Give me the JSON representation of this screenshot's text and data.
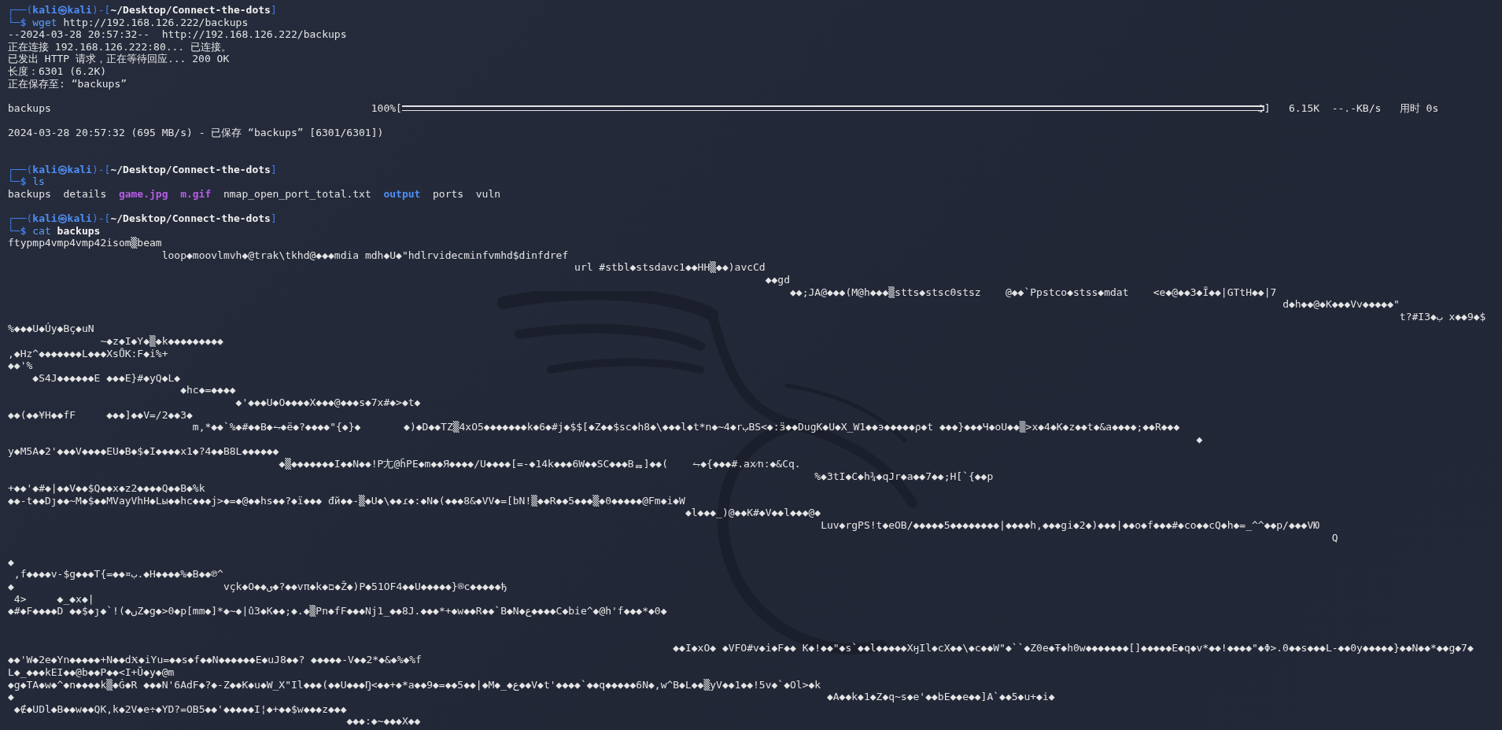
{
  "terminal": {
    "lines": [
      {
        "kind": "prompt",
        "open": "┌──(",
        "user": "kali㉿kali",
        "sep": ")-[",
        "path": "~/Desktop/Connect-the-dots",
        "close": "]"
      },
      {
        "kind": "command",
        "corner": "└─",
        "sign": "$",
        "command": "wget",
        "args": [
          {
            "text": "http://192.168.126.222/backups",
            "bold": false
          }
        ]
      },
      {
        "kind": "output",
        "text": "--2024-03-28 20:57:32--  http://192.168.126.222/backups"
      },
      {
        "kind": "output",
        "text": "正在连接 192.168.126.222:80... 已连接。"
      },
      {
        "kind": "output",
        "text": "已发出 HTTP 请求，正在等待回应... 200 OK"
      },
      {
        "kind": "output",
        "text": "长度：6301 (6.2K)"
      },
      {
        "kind": "output",
        "text": "正在保存至: “backups”"
      },
      {
        "kind": "blank"
      },
      {
        "kind": "progress",
        "file": "backups",
        "percent": "100%[",
        "level": 1,
        "close": "]",
        "size": "6.15K",
        "speed": "--.-KB/s",
        "time_label": "用时",
        "time": "0s"
      },
      {
        "kind": "blank"
      },
      {
        "kind": "output",
        "text": "2024-03-28 20:57:32 (695 MB/s) - 已保存 “backups” [6301/6301])"
      },
      {
        "kind": "blank"
      },
      {
        "kind": "blank"
      },
      {
        "kind": "prompt",
        "open": "┌──(",
        "user": "kali㉿kali",
        "sep": ")-[",
        "path": "~/Desktop/Connect-the-dots",
        "close": "]"
      },
      {
        "kind": "command",
        "corner": "└─",
        "sign": "$",
        "command": "ls"
      },
      {
        "kind": "listing",
        "entries": [
          {
            "name": "backups",
            "kind": "file"
          },
          {
            "name": "details",
            "kind": "file"
          },
          {
            "name": "game.jpg",
            "kind": "image"
          },
          {
            "name": "m.gif",
            "kind": "image"
          },
          {
            "name": "nmap_open_port_total.txt",
            "kind": "file"
          },
          {
            "name": "output",
            "kind": "directory"
          },
          {
            "name": "ports",
            "kind": "file"
          },
          {
            "name": "vuln",
            "kind": "file"
          }
        ]
      },
      {
        "kind": "blank"
      },
      {
        "kind": "prompt",
        "open": "┌──(",
        "user": "kali㉿kali",
        "sep": ")-[",
        "path": "~/Desktop/Connect-the-dots",
        "close": "]"
      },
      {
        "kind": "command",
        "corner": "└─",
        "sign": "$",
        "command": "cat",
        "args": [
          {
            "text": "backups",
            "bold": true
          }
        ]
      },
      {
        "kind": "output",
        "text": "ftypmp4vmp4vmp42isom▒beam"
      },
      {
        "kind": "output",
        "text": "                         loop◆moovlmvh◆@trak\\tkhd@◆◆◆mdia mdh◆U◆\"hdlrvidecminfvmhd$dinfdref"
      },
      {
        "kind": "output",
        "text": "                                                                                            url #stbl◆stsdavc1◆◆HH▒◆◆)avcCd"
      },
      {
        "kind": "output",
        "text": "                                                                                                                           ◆◆gd"
      },
      {
        "kind": "output",
        "text": "                                                                                                                               ◆◆;JA@◆◆◆(M@h◆◆◆▒stts◆stsc0stsz    @◆◆`Ppstco◆stss◆mdat    <e◆@◆◆3◆Ĩ◆◆|GTtH◆◆|7"
      },
      {
        "kind": "output",
        "text": "                                                                                                                                                                                                               d◆h◆◆@◆K◆◆◆Vv◆◆◆◆◆\""
      },
      {
        "kind": "output",
        "text": "                                                                                                                                                                                                                                  t?#I3◆ب x◆◆9◆$"
      },
      {
        "kind": "output",
        "text": "%◆◆◆U◆Úy◆Bç◆uN"
      },
      {
        "kind": "output",
        "text": "               ~◆z◆I◆Y◆▒◆k◆◆◆◆◆◆◆◆◆"
      },
      {
        "kind": "output",
        "text": ",◆Hz^◆◆◆◆◆◆◆L◆◆◆XsŮK:F◆i%+"
      },
      {
        "kind": "output",
        "text": "◆◆'%"
      },
      {
        "kind": "output",
        "text": "    ◆S4J◆◆◆◆◆◆E ◆◆◆E}#◆yQ◆L◆"
      },
      {
        "kind": "output",
        "text": "                            ◆hc◆=◆◆◆◆"
      },
      {
        "kind": "output",
        "text": "                                     ◆'◆◆◆U◆O◆◆◆◆X◆◆◆@◆◆◆s◆7x#◆>◆t◆"
      },
      {
        "kind": "output",
        "text": "◆◆(◆◆¥H◆◆fF     ◆◆◆]◆◆V=/2◆◆3◆"
      },
      {
        "kind": "output",
        "text": "                              m,*◆◆`%◆#◆◆B◆⥊◆ë◆?◆◆◆◆\"{◆}◆       ◆)◆D◆◆TZ▒4xO5◆◆◆◆◆◆◆k◆6◆#j◆$$[◆Z◆◆$sc◆h8◆\\◆◆◆l◆t*n◆~4◆rبBS<◆:ӟ◆◆DugK◆U◆X_W1◆◆э◆◆◆◆◆ρ◆t ◆◆◆}◆◆◆Ч◆oU◆◆▒>x◆4◆K◆z◆◆t◆&a◆◆◆◆;◆◆R◆◆◆"
      },
      {
        "kind": "output",
        "text": "                                                                                                                                                                                                 ◆"
      },
      {
        "kind": "output",
        "text": "y◆M5A◆2'◆◆◆V◆◆◆◆EU◆B◆$◆I◆◆◆◆x1◆?4◆◆B8L◆◆◆◆◆◆"
      },
      {
        "kind": "output",
        "text": "                                            ◆▒◆◆◆◆◆◆◆I◆◆N◆◆!P尢@ȟPE◆m◆◆Я◆◆◆◆/U◆◆◆◆[=-◆14k◆◆◆6W◆◆SC◆◆◆Bᆵ]◆◆(    ⥊◆{◆◆◆#.ax⁄n:◆&Cq."
      },
      {
        "kind": "output",
        "text": "                                                                                                                                   %◆3tI◆C◆h¾◆qJr◆a◆◆7◆◆;H[`{◆◆p"
      },
      {
        "kind": "output",
        "text": "+◆◆'◆#◆|◆◆V◆◆$Q◆◆x◆z2◆◆◆◆Q◆◆B◆%k"
      },
      {
        "kind": "output",
        "text": "◆◆-t◆◆Dȷ◆◆~M◆$◆◆MVayVhH◆Lы◆◆hc◆◆◆j>◆=◆@◆◆hs◆◆?◆ï◆◆◆ đй◆◆-▒◆U◆\\◆◆ɾ◆:◆N◆(◆◆◆8&◆VV◆=[bN!▒◆◆R◆◆5◆◆◆▒◆0◆◆◆◆◆@Fm◆i◆W"
      },
      {
        "kind": "output",
        "text": "                                                                                                              ◆l◆◆◆_)@◆◆K#◆V◆◆l◆◆◆@◆"
      },
      {
        "kind": "output",
        "text": "                                                                                                                                    Luv◆rgPS!t◆eOB/◆◆◆◆◆5◆◆◆◆◆◆◆◆|◆◆◆◆h,◆◆◆gi◆2◆)◆◆◆|◆◆o◆f◆◆◆#◆co◆◆cQ◆h◆=_^^◆◆p/◆◆◆VЮ"
      },
      {
        "kind": "output",
        "text": "                                                                                                                                                                                                                       Q"
      },
      {
        "kind": "blank"
      },
      {
        "kind": "output",
        "text": "◆"
      },
      {
        "kind": "output",
        "text": " ,f◆◆◆◆v-$g◆◆◆T{=◆◆¤ب.◆H◆◆◆◆%◆B◆◆℗^"
      },
      {
        "kind": "output",
        "text": "◆                                  vçk◆O◆◆ی◆?◆◆vπ◆k◆ם◆Ž◆)P◆51OF4◆◆U◆◆◆◆◆}®c◆◆◆◆◆ђ"
      },
      {
        "kind": "output",
        "text": " 4>     ◆_◆x◆|"
      },
      {
        "kind": "output",
        "text": "◆#◆F◆◆◆◆D ◆◆$◆ȷ◆`!(◆ﮞZ◆g◆>0◆p[mm◆]*◆~◆|û3◆K◆◆;◆.◆▒Pn◆fF◆◆◆Nj1_◆◆8J.◆◆◆*+◆w◆◆R◆◆`B◆N◆ﻉ◆◆◆◆C◆bie^◆@h'f◆◆◆*◆0◆"
      },
      {
        "kind": "blank"
      },
      {
        "kind": "blank"
      },
      {
        "kind": "output",
        "text": "                                                                                                            ◆◆I◆xO◆ ◆VFO#v◆i◆F◆◆ K◆!◆◆\"◆s`◆◆l◆◆◆◆◆XӈӀl◆cX◆◆\\◆c◆◆W\"◆``◆Z0e◆Ŧ◆h0w◆◆◆◆◆◆◆[]◆◆◆◆◆E◆q◆v*◆◆!◆◆◆◆\"◆Φ>.0◆◆s◆◆◆L-◆◆0y◆◆◆◆◆}◆◆N◆◆*◆◆g◆7◆"
      },
      {
        "kind": "output",
        "text": "◆◆'W◆2e◆Yn◆◆◆◆◆+N◆◆dӾ◆iYu=◆◆s◆f◆◆N◆◆◆◆◆◆E◆uJ8◆◆? ◆◆◆◆◆-V◆◆2*◆&◆%◆%f"
      },
      {
        "kind": "output",
        "text": "L◆_◆◆◆kEI◆◆@b◆◆P◆◆<I+Ŭ◆y◆@m"
      },
      {
        "kind": "output",
        "text": "◆g◆TA◆w◆^◆n◆◆◆◆k▒◆Ġ◆R ◆◆◆N'6AdF◆?◆-Z◆◆K◆u◆W_X\"Il◆◆◆(◆◆U◆◆◆Ŋ<◆◆+◆*a◆◆9◆=◆◆5◆◆|◆M◆_◆ع◆◆V◆t'◆◆◆◆`◆◆q◆◆◆◆◆6N◆,w^B◆L◆◆▒yV◆◆1◆◆!5v◆`◆Ol>◆k"
      },
      {
        "kind": "output",
        "text": "◆                                                                                                                                    ◆A◆◆k◆1◆Z◆q~s◆e'◆◆bE◆◆e◆◆]A`◆◆5◆u+◆i◆"
      },
      {
        "kind": "output",
        "text": " ◆∉◆UDl◆B◆◆w◆◆QK,k◆2V◆e÷◆YD?=OB5◆◆'◆◆◆◆◆I¦◆+◆◆$w◆◆◆z◆◆◆"
      },
      {
        "kind": "output",
        "text": "                                                       ◆◆◆:◆~◆◆◆X◆◆"
      }
    ]
  }
}
